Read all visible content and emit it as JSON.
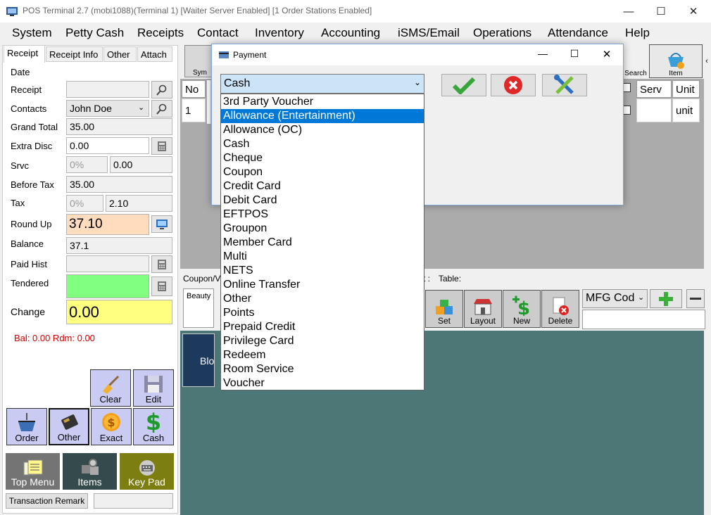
{
  "window": {
    "title": "POS Terminal 2.7 (mobi1088)(Terminal 1) [Waiter Server Enabled] [1 Order Stations Enabled]"
  },
  "menu": [
    "System",
    "Petty Cash",
    "Receipts",
    "Contact",
    "Inventory",
    "Accounting",
    "iSMS/Email",
    "Operations",
    "Attendance",
    "Help"
  ],
  "tabs": [
    "Receipt",
    "Receipt Info",
    "Other",
    "Attach"
  ],
  "receipt": {
    "date_label": "Date",
    "receipt_label": "Receipt",
    "contacts_label": "Contacts",
    "contacts_value": "John Doe",
    "grand_total_label": "Grand Total",
    "grand_total_value": "35.00",
    "extra_disc_label": "Extra Disc",
    "extra_disc_value": "0.00",
    "srvc_label": "Srvc",
    "srvc_pct": "0%",
    "srvc_value": "0.00",
    "before_tax_label": "Before Tax",
    "before_tax_value": "35.00",
    "tax_label": "Tax",
    "tax_pct": "0%",
    "tax_value": "2.10",
    "round_up_label": "Round Up",
    "round_up_value": "37.10",
    "balance_label": "Balance",
    "balance_value": "37.1",
    "paid_hist_label": "Paid Hist",
    "tendered_label": "Tendered",
    "change_label": "Change",
    "change_value": "0.00",
    "bal_rdm": "Bal: 0.00 Rdm: 0.00"
  },
  "buttons": {
    "clear": "Clear",
    "edit": "Edit",
    "order": "Order",
    "other": "Other",
    "exact": "Exact",
    "cash": "Cash",
    "top_menu": "Top Menu",
    "items": "Items",
    "key_pad": "Key Pad",
    "transaction_remark": "Transaction Remark"
  },
  "toolbar": {
    "sym": "Sym",
    "search": "Search",
    "item": "Item"
  },
  "grid": {
    "headers": [
      "No",
      "Serv",
      "Unit"
    ],
    "row": {
      "no": "1",
      "unit": "unit"
    }
  },
  "mid": {
    "coupon": "Coupon/V",
    "t_label": "t :",
    "table_label": "Table:",
    "beauty": "Beauty Sa",
    "set": "Set",
    "layout": "Layout",
    "new": "New",
    "delete": "Delete",
    "mfg": "MFG Cod",
    "blow": "Blow"
  },
  "dialog": {
    "title": "Payment",
    "selected": "Cash"
  },
  "payment_options": [
    "3rd Party Voucher",
    "Allowance (Entertainment)",
    "Allowance (OC)",
    "Cash",
    "Cheque",
    "Coupon",
    "Credit Card",
    "Debit Card",
    "EFTPOS",
    "Groupon",
    "Member Card",
    "Multi",
    "NETS",
    "Online Transfer",
    "Other",
    "Points",
    "Prepaid Credit",
    "Privilege Card",
    "Redeem",
    "Room Service",
    "Voucher"
  ],
  "highlighted_option": "Allowance (Entertainment)",
  "colors": {
    "round_up_bg": "#ffdcbd",
    "tendered_bg": "#80ff80",
    "change_bg": "#ffff80",
    "teal": "#4d7777",
    "highlight": "#0078d7",
    "bal_text": "#d00000"
  }
}
